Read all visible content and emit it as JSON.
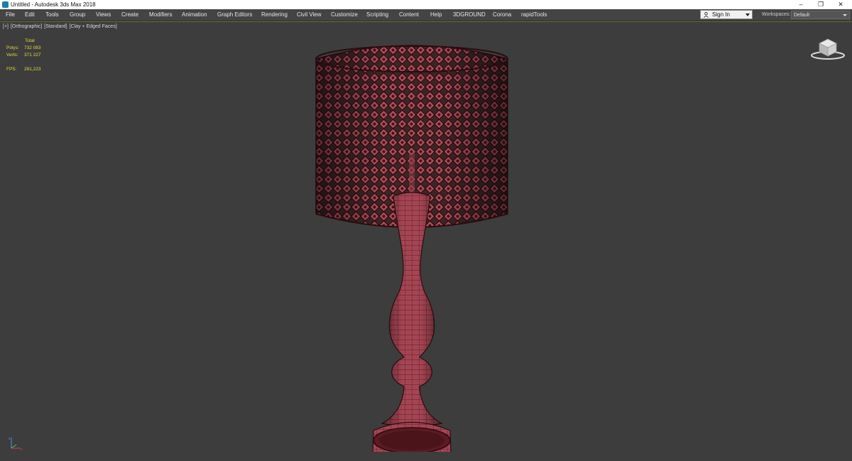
{
  "window": {
    "title": "Untitled - Autodesk 3ds Max 2018",
    "controls": {
      "minimize": "–",
      "restore": "❐",
      "close": "✕"
    }
  },
  "menubar": {
    "items": [
      "File",
      "Edit",
      "Tools",
      "Group",
      "Views",
      "Create",
      "Modifiers",
      "Animation",
      "Graph Editors",
      "Rendering",
      "Civil View",
      "Customize",
      "Scripting",
      "Content",
      "Help",
      "3DGROUND",
      "Corona",
      "rapidTools"
    ]
  },
  "account": {
    "signin_label": "Sign In",
    "workspaces_label": "Workspaces:",
    "workspace_value": "Default"
  },
  "viewport": {
    "label_plus": "[+]",
    "label_view": "[Orthographic]",
    "label_shading": "[Standard]",
    "label_style": "[Clay + Edged Faces]",
    "stats": {
      "header": "Total",
      "polys_label": "Polys:",
      "polys_value": "732 083",
      "verts_label": "Verts:",
      "verts_value": "371 227",
      "fps_label": "FPS:",
      "fps_value": "281,223"
    }
  },
  "icons": [
    "app-icon",
    "user-icon",
    "viewcube-icon",
    "axis-tripod-icon"
  ],
  "colors": {
    "viewport_bg": "#3d3d3d",
    "menubar_bg": "#444444",
    "stat_text": "#e4d93a",
    "model_fill": "#a0454f",
    "model_wire": "#3a0f14"
  }
}
